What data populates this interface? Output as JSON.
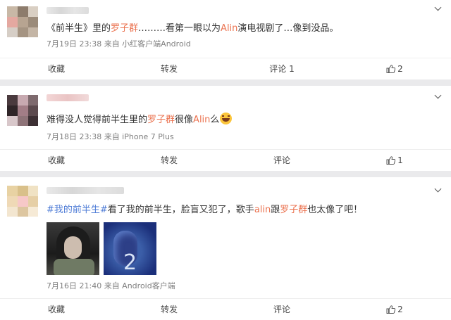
{
  "posts": [
    {
      "text_parts": [
        {
          "t": "《前半生》里的",
          "c": "normal"
        },
        {
          "t": "罗子群",
          "c": "hl"
        },
        {
          "t": "………看第一眼以为",
          "c": "normal"
        },
        {
          "t": "Alin",
          "c": "hl"
        },
        {
          "t": "演电视剧了…像到没品。",
          "c": "normal"
        }
      ],
      "meta": "7月19日 23:38 来自 小红客户端Android",
      "actions": {
        "fav": "收藏",
        "repost": "转发",
        "comment": "评论 1",
        "like": "2"
      }
    },
    {
      "text_parts": [
        {
          "t": "难得没人觉得前半生里的",
          "c": "normal"
        },
        {
          "t": "罗子群",
          "c": "hl"
        },
        {
          "t": "很像",
          "c": "normal"
        },
        {
          "t": "Alin",
          "c": "hl"
        },
        {
          "t": "么",
          "c": "normal"
        }
      ],
      "emoji": "laughing-tears-emoji",
      "meta": "7月18日 23:38 来自 iPhone 7 Plus",
      "actions": {
        "fav": "收藏",
        "repost": "转发",
        "comment": "评论",
        "like": "1"
      }
    },
    {
      "text_parts": [
        {
          "t": "#我的前半生#",
          "c": "link"
        },
        {
          "t": "看了我的前半生，脸盲又犯了，歌手",
          "c": "normal"
        },
        {
          "t": "alin",
          "c": "hl"
        },
        {
          "t": "跟",
          "c": "normal"
        },
        {
          "t": "罗子群",
          "c": "hl"
        },
        {
          "t": "也太像了吧！",
          "c": "normal"
        }
      ],
      "images": [
        "photo-woman-long-hair",
        "photo-woman-blue-poster"
      ],
      "thumb2_number": "2",
      "meta": "7月16日 21:40 来自 Android客户端",
      "actions": {
        "fav": "收藏",
        "repost": "转发",
        "comment": "评论",
        "like": "2"
      }
    }
  ],
  "colors": {
    "highlight": "#eb7350",
    "link": "#4d7bd6",
    "meta": "#808080",
    "background": "#eaeaec"
  }
}
